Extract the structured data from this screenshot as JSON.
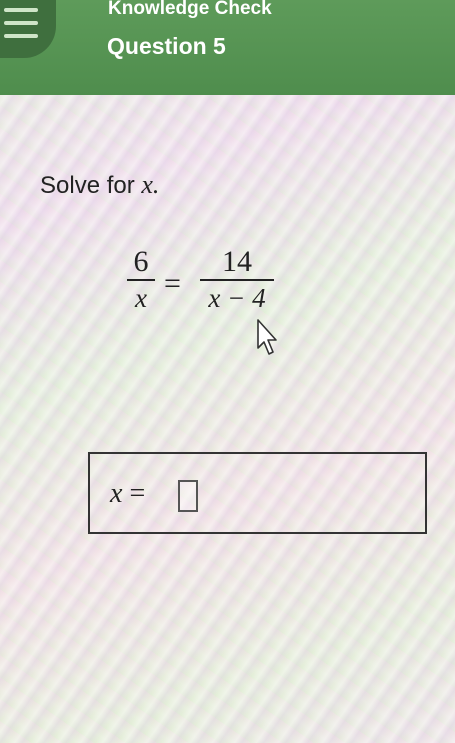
{
  "header": {
    "title": "Knowledge Check",
    "subtitle": "Question 5",
    "menu_icon": "hamburger-menu-icon",
    "background_color": "#5a9656"
  },
  "question": {
    "prompt_text": "Solve for ",
    "prompt_variable": "x.",
    "equation": {
      "left_numerator": "6",
      "left_denominator": "x",
      "equals": "=",
      "right_numerator": "14",
      "right_denominator": "x − 4"
    }
  },
  "answer": {
    "label_variable": "x",
    "label_equals": " = ",
    "value": ""
  },
  "cursor_icon": "pointer-arrow-icon"
}
